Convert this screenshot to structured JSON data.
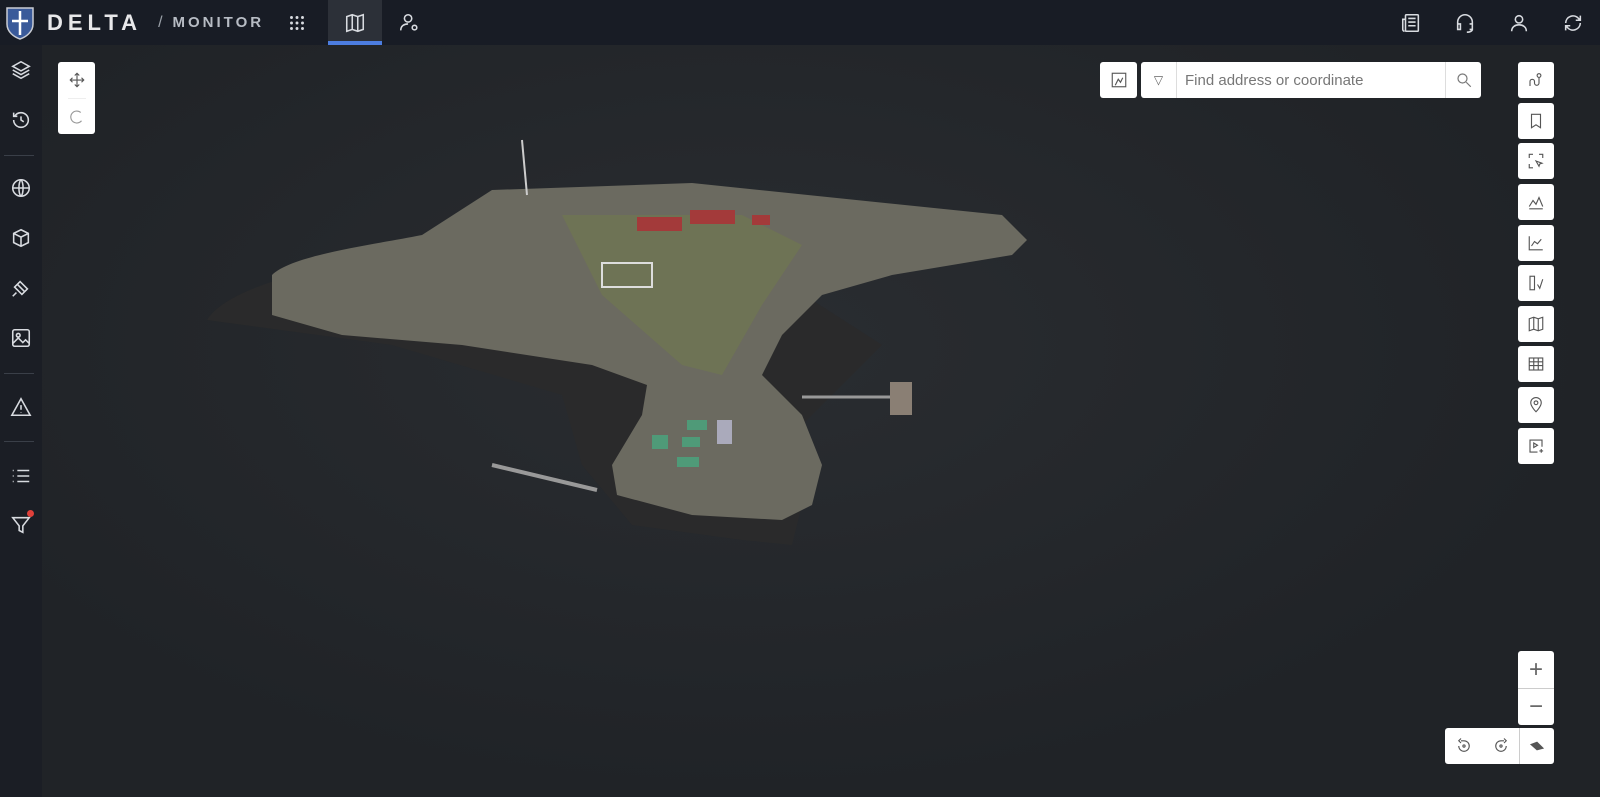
{
  "header": {
    "brand": "DELTA",
    "separator": "/",
    "module": "MONITOR"
  },
  "search": {
    "placeholder": "Find address or coordinate",
    "value": ""
  },
  "colors": {
    "accent": "#4c7de0",
    "topbar": "#181c25",
    "notification_dot": "#e0403a"
  }
}
